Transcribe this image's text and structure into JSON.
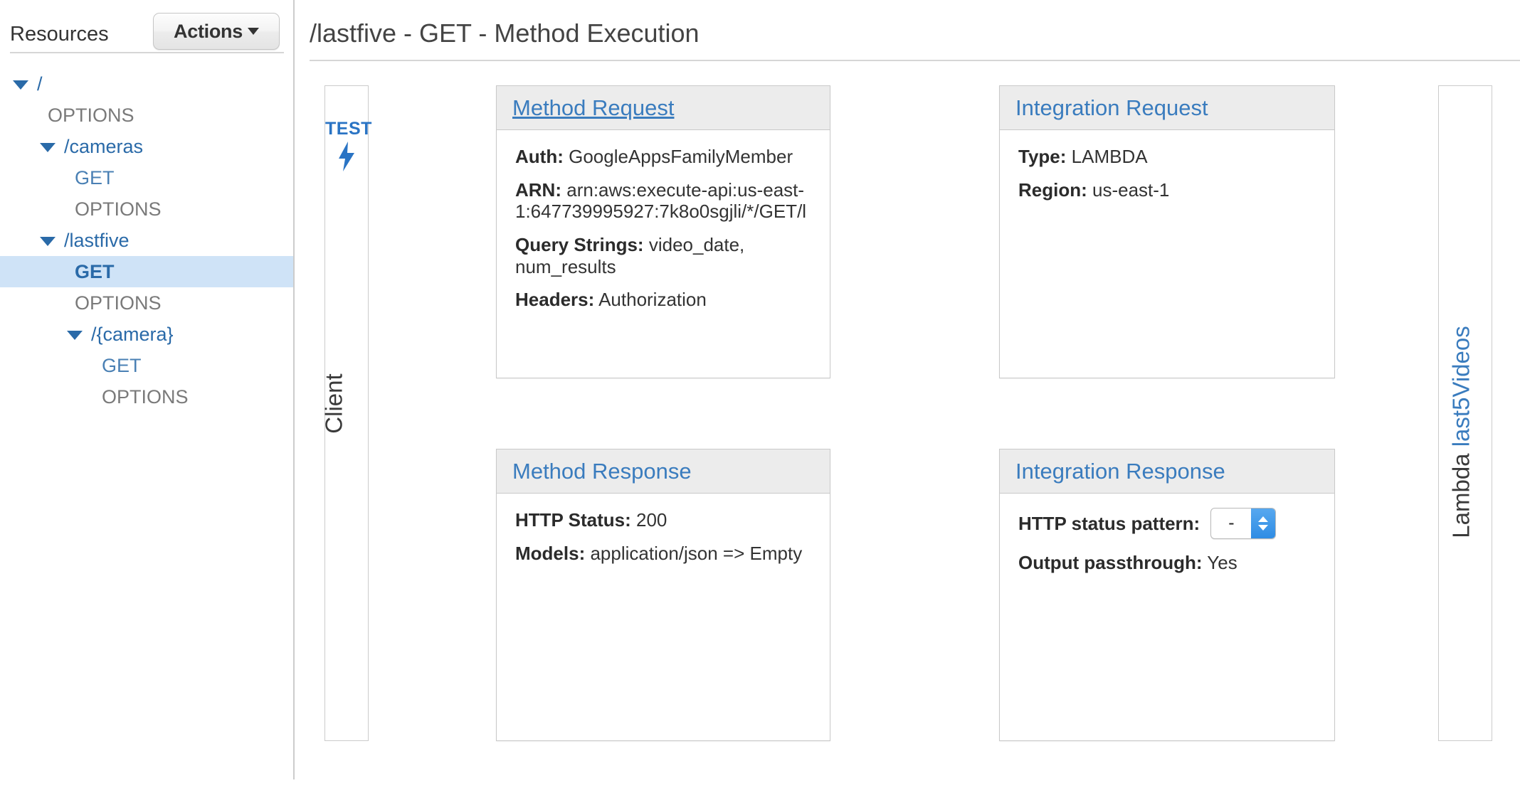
{
  "sidebar": {
    "title": "Resources",
    "actions_button": "Actions",
    "tree": [
      {
        "label": "/",
        "type": "resource",
        "depth": 0,
        "caret": true,
        "selected": false
      },
      {
        "label": "OPTIONS",
        "type": "options",
        "depth": 1,
        "caret": false,
        "selected": false
      },
      {
        "label": "/cameras",
        "type": "resource",
        "depth": 1,
        "caret": true,
        "selected": false
      },
      {
        "label": "GET",
        "type": "get",
        "depth": 2,
        "caret": false,
        "selected": false
      },
      {
        "label": "OPTIONS",
        "type": "options",
        "depth": 2,
        "caret": false,
        "selected": false
      },
      {
        "label": "/lastfive",
        "type": "resource",
        "depth": 1,
        "caret": true,
        "selected": false
      },
      {
        "label": "GET",
        "type": "get",
        "depth": 2,
        "caret": false,
        "selected": true
      },
      {
        "label": "OPTIONS",
        "type": "options",
        "depth": 2,
        "caret": false,
        "selected": false
      },
      {
        "label": "/{camera}",
        "type": "resource",
        "depth": 2,
        "caret": true,
        "selected": false
      },
      {
        "label": "GET",
        "type": "get",
        "depth": 3,
        "caret": false,
        "selected": false
      },
      {
        "label": "OPTIONS",
        "type": "options",
        "depth": 3,
        "caret": false,
        "selected": false
      }
    ]
  },
  "main": {
    "page_title": "/lastfive - GET - Method Execution",
    "client_column": {
      "test_label": "TEST",
      "test_icon": "lightning-bolt-icon",
      "client_label": "Client"
    },
    "lambda_column": {
      "lambda_label": "Lambda",
      "lambda_function_link": "last5Videos"
    },
    "method_request": {
      "title": "Method Request",
      "auth_label": "Auth:",
      "auth_value": "GoogleAppsFamilyMember",
      "arn_label": "ARN:",
      "arn_value": "arn:aws:execute-api:us-east-1:647739995927:7k8o0sgjli/*/GET/l",
      "query_strings_label": "Query Strings:",
      "query_strings_value": "video_date, num_results",
      "headers_label": "Headers:",
      "headers_value": "Authorization"
    },
    "integration_request": {
      "title": "Integration Request",
      "type_label": "Type:",
      "type_value": "LAMBDA",
      "region_label": "Region:",
      "region_value": "us-east-1"
    },
    "method_response": {
      "title": "Method Response",
      "http_status_label": "HTTP Status:",
      "http_status_value": "200",
      "models_label": "Models:",
      "models_value": "application/json => Empty"
    },
    "integration_response": {
      "title": "Integration Response",
      "status_pattern_label": "HTTP status pattern:",
      "status_pattern_value": "-",
      "output_passthrough_label": "Output passthrough:",
      "output_passthrough_value": "Yes"
    }
  },
  "colors": {
    "link_blue": "#3a7cbe",
    "tree_blue": "#2a6aa8",
    "selected_row": "#cfe3f7",
    "panel_head": "#ececec",
    "arrow_gray": "#a8a8a8",
    "select_blue": "#2f8ce4"
  }
}
